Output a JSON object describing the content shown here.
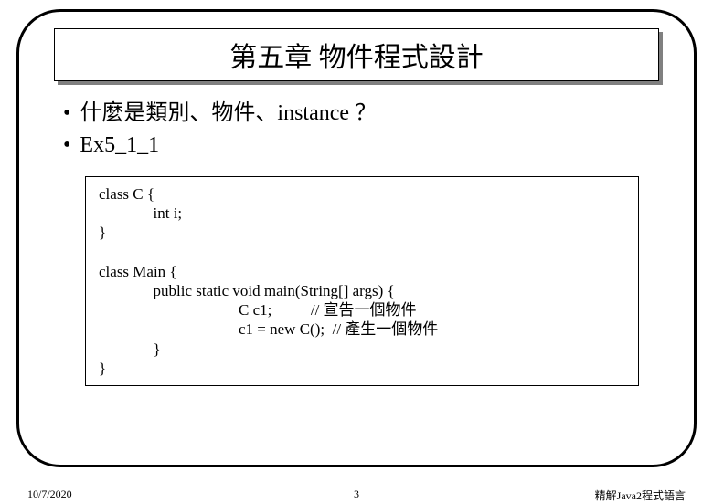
{
  "title": "第五章 物件程式設計",
  "bullets": [
    "什麼是類別、物件、instance ？",
    "Ex5_1_1"
  ],
  "code": "class C {\n              int i;\n}\n\nclass Main {\n              public static void main(String[] args) {\n                                    C c1;          // 宣告一個物件\n                                    c1 = new C();  // 產生一個物件\n              }\n}",
  "footer": {
    "date": "10/7/2020",
    "page": "3",
    "book": "精解Java2程式語言"
  }
}
